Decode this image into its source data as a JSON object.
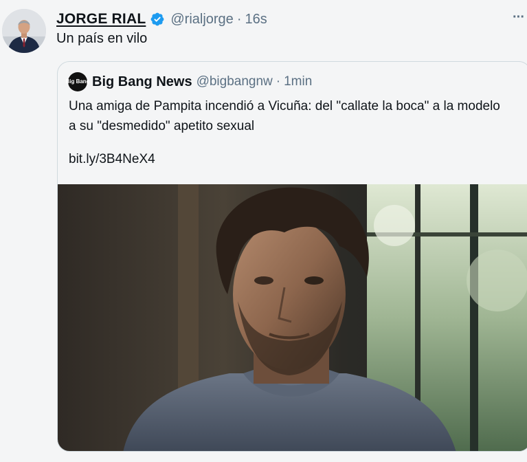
{
  "tweet": {
    "name": "JORGE RIAL",
    "handle": "@rialjorge",
    "separator": "·",
    "time": "16s",
    "text": "Un país en vilo",
    "more_icon": "···"
  },
  "quote": {
    "avatar_text": "Big Bang",
    "name": "Big Bang News",
    "handle": "@bigbangnw",
    "separator": "·",
    "time": "1min",
    "text": "Una amiga de Pampita incendió a Vicuña: del \"callate la boca\" a la modelo a su \"desmedido\" apetito sexual",
    "link": "bit.ly/3B4NeX4"
  },
  "colors": {
    "verified": "#1d9bf0",
    "secondary_text": "#5b7083",
    "border": "#cfd9de",
    "background": "#f4f5f6"
  },
  "icons": {
    "verified": "verified-badge-icon",
    "more": "more-icon"
  }
}
